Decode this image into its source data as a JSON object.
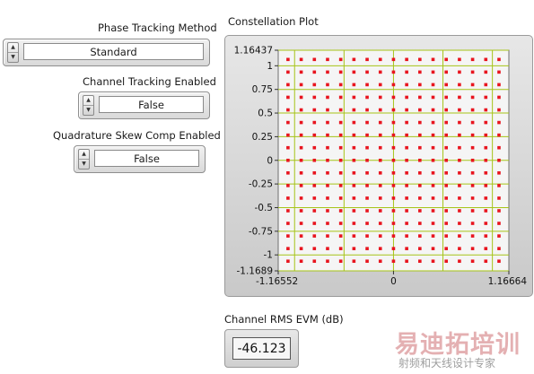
{
  "controls": {
    "phase_tracking": {
      "label": "Phase Tracking Method",
      "value": "Standard"
    },
    "channel_tracking": {
      "label": "Channel Tracking Enabled",
      "value": "False"
    },
    "quadrature_skew": {
      "label": "Quadrature Skew Comp Enabled",
      "value": "False"
    }
  },
  "graph": {
    "title": "Constellation Plot"
  },
  "evm": {
    "label": "Channel RMS EVM (dB)",
    "value": "-46.123"
  },
  "watermark": {
    "text": "易迪拓培训",
    "subtext": "射频和天线设计专家"
  },
  "chart_data": {
    "type": "scatter",
    "title": "Constellation Plot",
    "xlabel": "",
    "ylabel": "",
    "xlim": [
      -1.16552,
      1.16664
    ],
    "ylim": [
      -1.1689,
      1.16437
    ],
    "x_ticks": [
      "-1.16552",
      "0",
      "1.16664"
    ],
    "y_ticks": [
      "1.16437",
      "1",
      "0.75",
      "0.5",
      "0.25",
      "0",
      "-0.25",
      "-0.5",
      "-0.75",
      "-1",
      "-1.1689"
    ],
    "grid": true,
    "grid_color": "#a6c418",
    "point_color": "#e8141e",
    "background": "#f5f5f5",
    "point_levels": [
      -1.0667,
      -0.9333,
      -0.8,
      -0.6667,
      -0.5333,
      -0.4,
      -0.2667,
      -0.1333,
      0,
      0.1333,
      0.2667,
      0.4,
      0.5333,
      0.6667,
      0.8,
      0.9333,
      1.0667
    ],
    "series": [
      {
        "points": "17 x 17 constellation grid at point_levels (I and Q)"
      }
    ]
  }
}
